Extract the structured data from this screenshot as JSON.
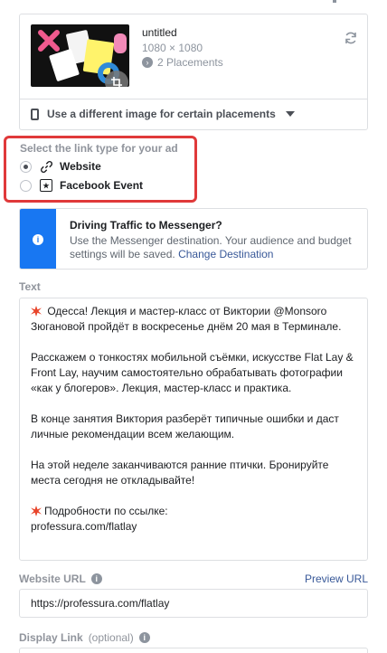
{
  "media": {
    "title": "untitled",
    "dimensions": "1080 × 1080",
    "placements": "2 Placements",
    "different_image_label": "Use a different image for certain placements"
  },
  "link_type": {
    "label": "Select the link type for your ad",
    "options": [
      {
        "label": "Website",
        "icon": "link-icon",
        "selected": true
      },
      {
        "label": "Facebook Event",
        "icon": "event-icon",
        "selected": false
      }
    ],
    "highlight_color": "#e0393a"
  },
  "messenger_info": {
    "title": "Driving Traffic to Messenger?",
    "body": "Use the Messenger destination. Your audience and budget settings will be saved.",
    "link": "Change Destination",
    "accent_color": "#1877f2"
  },
  "text_section": {
    "label": "Text",
    "paragraphs": [
      {
        "spark": true,
        "text": " Одесса! Лекция и мастер-класс от Виктории @Monsoro Зюгановой пройдёт в воскресенье днём 20 мая в Терминале."
      },
      {
        "spark": false,
        "text": "Расскажем о тонкостях мобильной съёмки, искусстве Flat Lay & Front Lay, научим самостоятельно обрабатывать фотографии «как у блогеров». Лекция, мастер-класс и практика."
      },
      {
        "spark": false,
        "text": "В конце занятия Виктория разберёт типичные ошибки и даст личные рекомендации всем желающим."
      },
      {
        "spark": false,
        "text": "На этой неделе заканчиваются ранние птички. Бронируйте места сегодня не откладывайте!"
      },
      {
        "spark": true,
        "text": "Подробности по ссылке:",
        "line2": "professura.com/flatlay"
      }
    ]
  },
  "website_url": {
    "label": "Website URL",
    "preview_link": "Preview URL",
    "value": "https://professura.com/flatlay"
  },
  "display_link": {
    "label": "Display Link",
    "optional": "(optional)"
  }
}
